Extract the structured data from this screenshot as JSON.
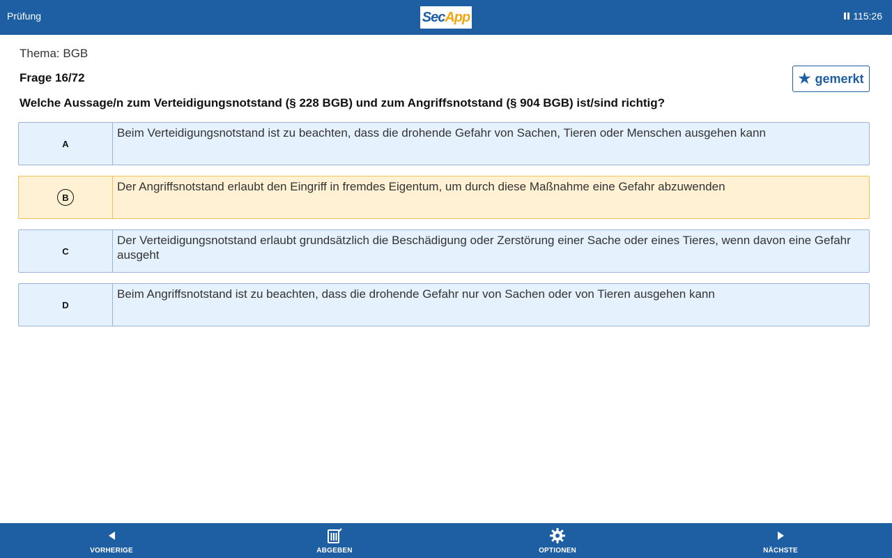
{
  "header": {
    "title": "Prüfung",
    "logo_sec": "Sec",
    "logo_app": "App",
    "timer": "115:26"
  },
  "exam": {
    "topic": "Thema: BGB",
    "question_number": "Frage 16/72",
    "mark_label": "gemerkt",
    "question": "Welche Aussage/n zum Verteidigungsnotstand (§ 228 BGB) und zum Angriffsnotstand (§ 904 BGB) ist/sind richtig?",
    "answers": [
      {
        "letter": "A",
        "text": "Beim Verteidigungsnotstand ist zu beachten, dass die drohende Gefahr von Sachen, Tieren oder Menschen ausgehen kann",
        "selected": false
      },
      {
        "letter": "B",
        "text": "Der Angriffsnotstand erlaubt den Eingriff in fremdes Eigentum, um durch diese Maßnahme eine Gefahr abzuwenden",
        "selected": true
      },
      {
        "letter": "C",
        "text": "Der Verteidigungsnotstand erlaubt grundsätzlich die Beschädigung oder Zerstörung einer Sache oder eines Tieres, wenn davon eine Gefahr ausgeht",
        "selected": false
      },
      {
        "letter": "D",
        "text": "Beim Angriffsnotstand ist zu beachten, dass die drohende Gefahr nur von Sachen oder von Tieren ausgehen kann",
        "selected": false
      }
    ]
  },
  "footer": {
    "prev_label": "VORHERIGE",
    "submit_label": "ABGEBEN",
    "options_label": "OPTIONEN",
    "next_label": "NÄCHSTE"
  },
  "icons": {
    "pause": "pause-icon",
    "star": "star-icon",
    "prev": "chevron-left-icon",
    "submit": "submit-icon",
    "options": "gear-icon",
    "next": "chevron-right-icon"
  },
  "colors": {
    "primary": "#1e5fa3",
    "logo_accent": "#f3a712",
    "answer_bg": "#e5f1fd",
    "answer_selected_bg": "#fff1d4",
    "answer_selected_border": "#f2c35a"
  }
}
